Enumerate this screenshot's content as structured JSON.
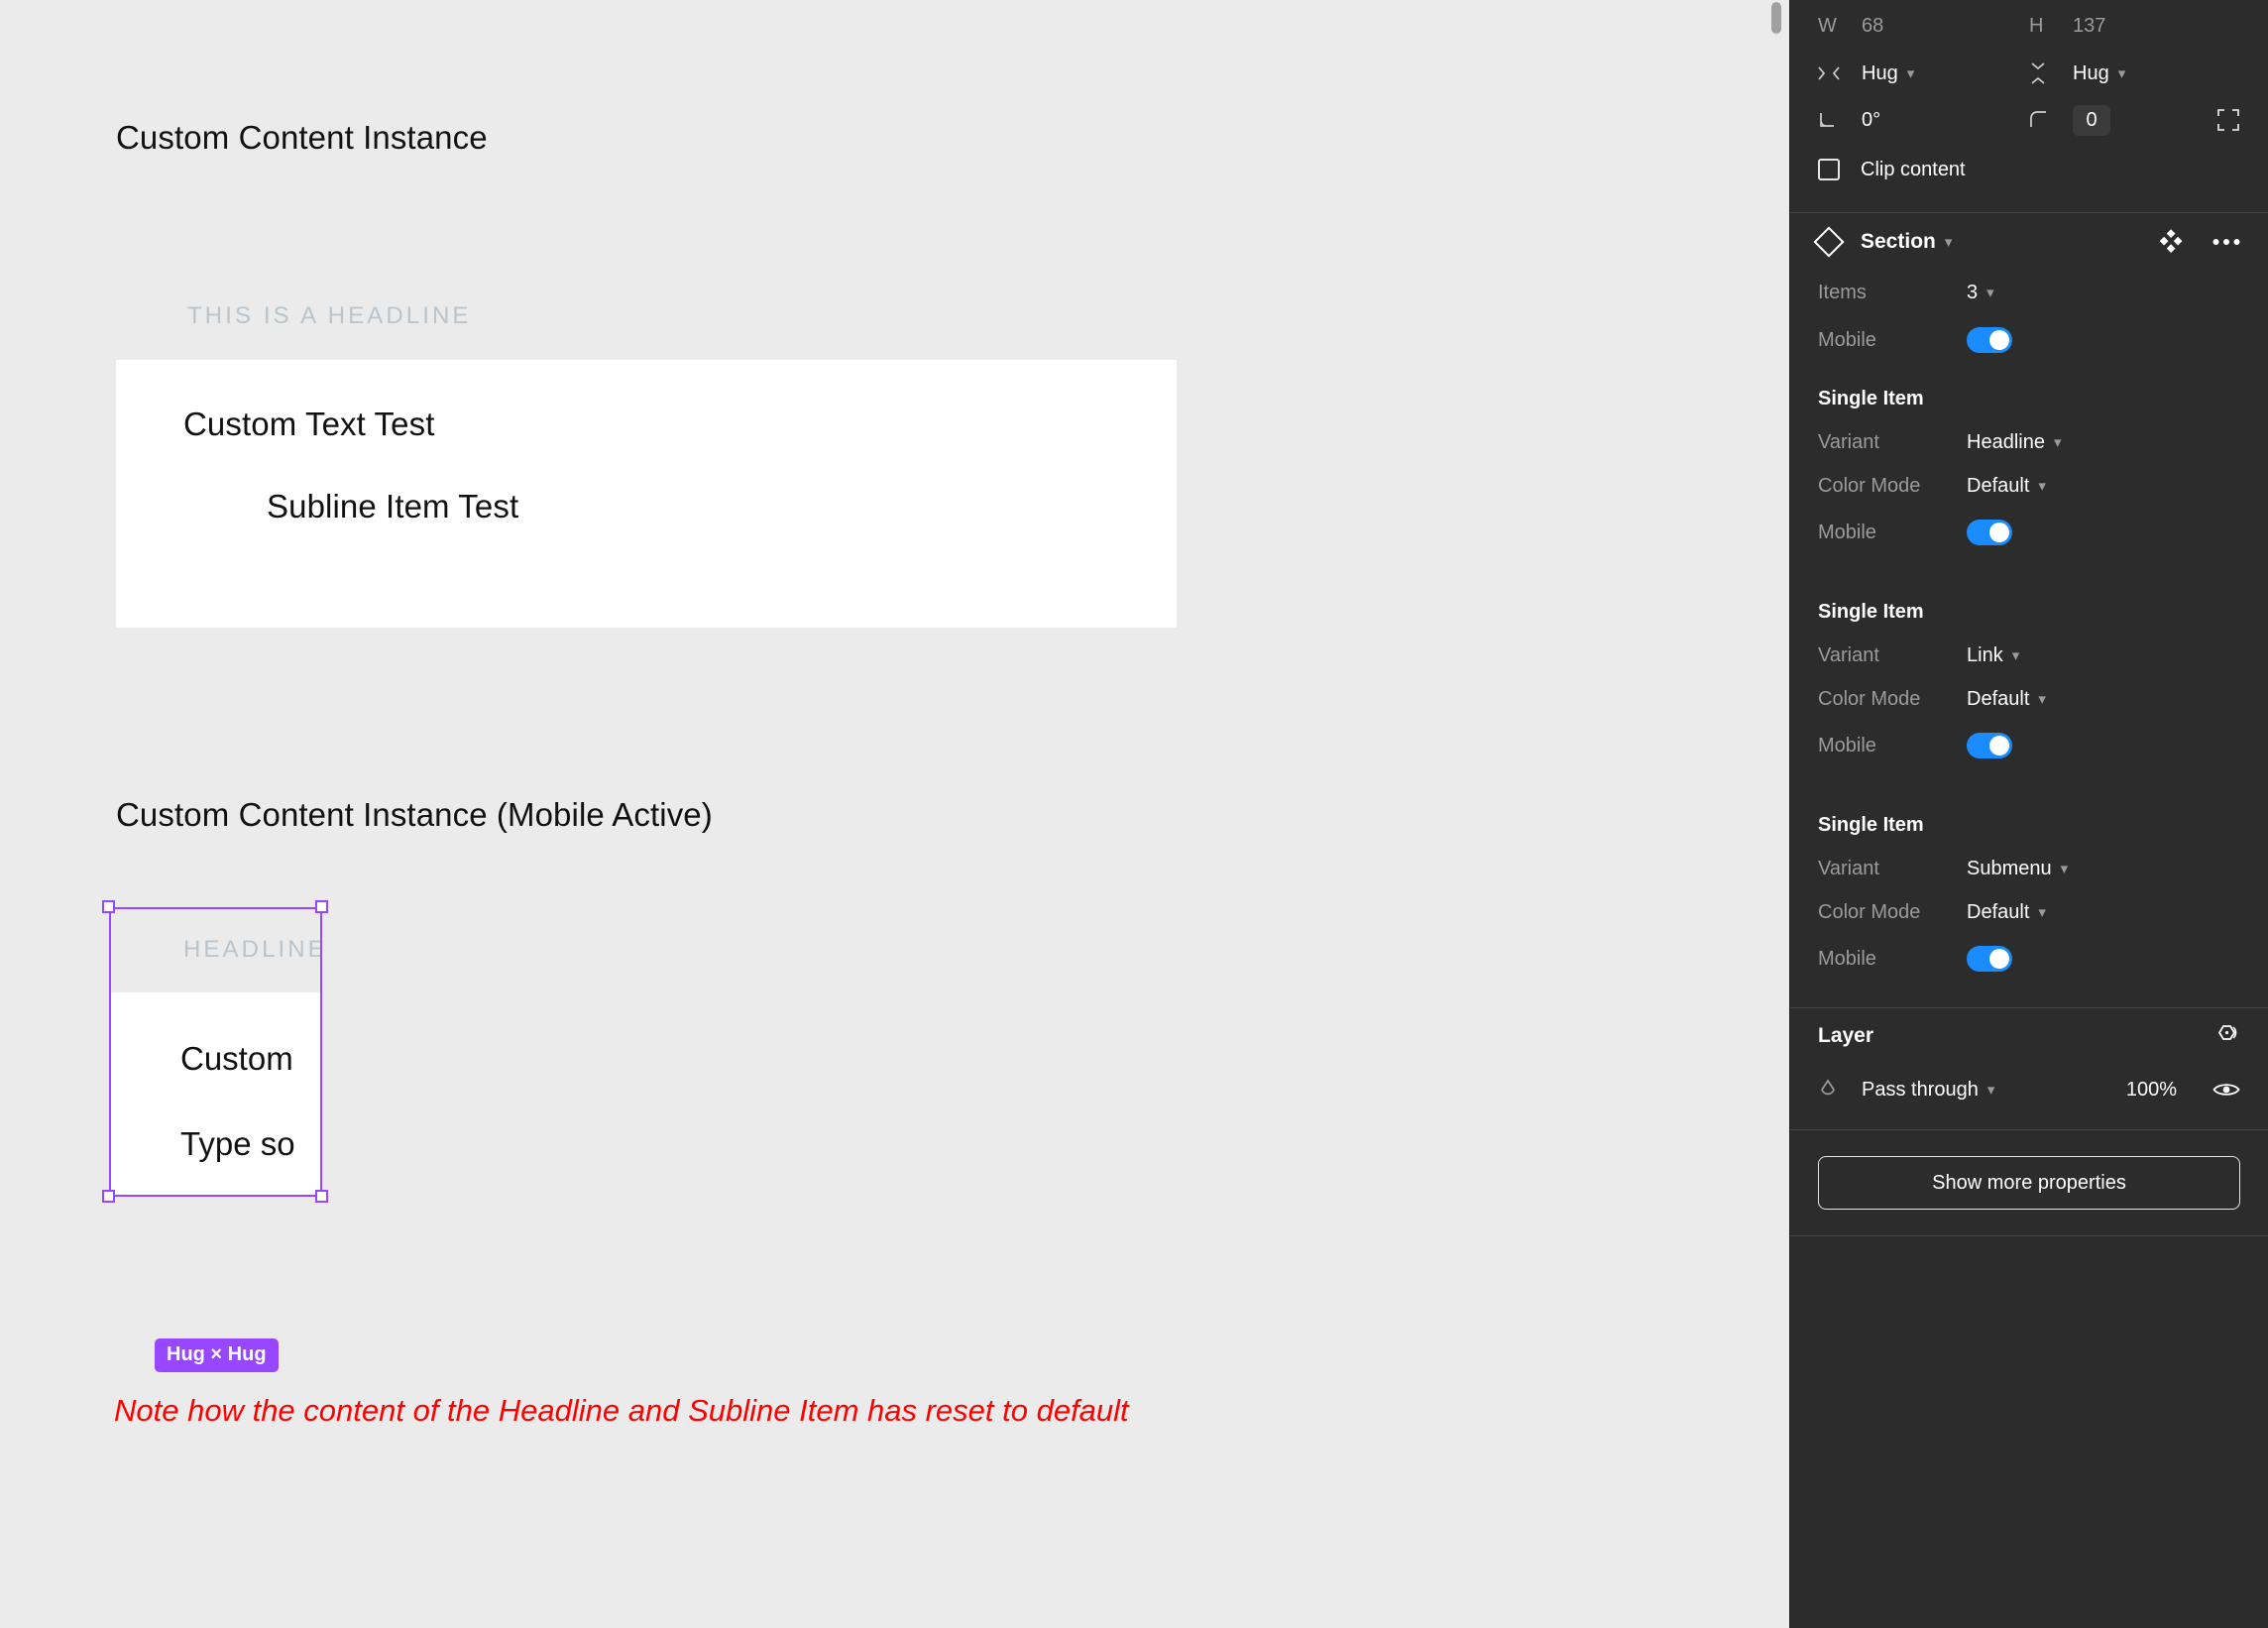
{
  "canvas": {
    "background_color": "#ebebeb",
    "frames": [
      {
        "title": "Custom Content Instance",
        "headline": "THIS IS A HEADLINE",
        "card_line_main": "Custom Text Test",
        "card_line_sub": "Subline Item Test"
      },
      {
        "title": "Custom Content Instance (Mobile Active)",
        "headline": "HEADLINE",
        "card_line_main": "Custom",
        "card_line_sub": "Type so"
      }
    ],
    "selection": {
      "size_badge": "Hug × Hug",
      "selection_color": "#9747ff"
    },
    "note": "Note how the content of the Headline and Subline Item has reset to default",
    "note_color": "#ff0000"
  },
  "panel": {
    "size": {
      "width_label": "W",
      "width_value": "68",
      "height_label": "H",
      "height_value": "137",
      "horizontal_resize": "Hug",
      "vertical_resize": "Hug",
      "rotation": "0°",
      "corner_radius": "0",
      "clip_content_label": "Clip content"
    },
    "component": {
      "name": "Section",
      "items_label": "Items",
      "items_value": "3",
      "mobile_label": "Mobile",
      "groups": [
        {
          "title": "Single Item",
          "variant_label": "Variant",
          "variant_value": "Headline",
          "color_mode_label": "Color Mode",
          "color_mode_value": "Default",
          "mobile_label": "Mobile",
          "mobile_on": true
        },
        {
          "title": "Single Item",
          "variant_label": "Variant",
          "variant_value": "Link",
          "color_mode_label": "Color Mode",
          "color_mode_value": "Default",
          "mobile_label": "Mobile",
          "mobile_on": true
        },
        {
          "title": "Single Item",
          "variant_label": "Variant",
          "variant_value": "Submenu",
          "color_mode_label": "Color Mode",
          "color_mode_value": "Default",
          "mobile_label": "Mobile",
          "mobile_on": true
        }
      ]
    },
    "layer": {
      "title": "Layer",
      "blend_mode": "Pass through",
      "opacity": "100%"
    },
    "show_more_label": "Show more properties",
    "accent_color": "#1a8cff",
    "background_color": "#2c2c2c"
  }
}
